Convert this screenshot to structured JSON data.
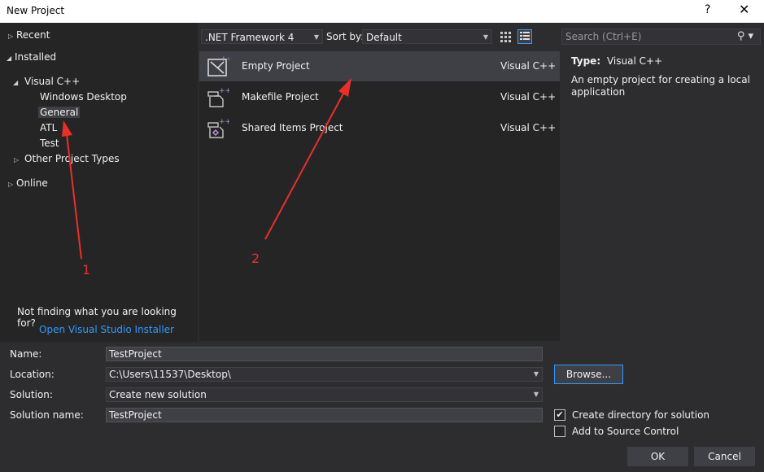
{
  "window": {
    "title": "New Project",
    "help": "?",
    "close": "✕"
  },
  "tree": {
    "recent": "Recent",
    "installed": "Installed",
    "visual_cpp": "Visual C++",
    "windows_desktop": "Windows Desktop",
    "general": "General",
    "atl": "ATL",
    "test": "Test",
    "other_types": "Other Project Types",
    "online": "Online"
  },
  "left_footer": {
    "not_finding": "Not finding what you are looking for?",
    "installer_link": "Open Visual Studio Installer"
  },
  "toolbar": {
    "framework": ".NET Framework 4",
    "sort_by_label": "Sort by:",
    "sort_value": "Default"
  },
  "projects": [
    {
      "name": "Empty Project",
      "lang": "Visual C++"
    },
    {
      "name": "Makefile Project",
      "lang": "Visual C++"
    },
    {
      "name": "Shared Items Project",
      "lang": "Visual C++"
    }
  ],
  "details": {
    "search_placeholder": "Search (Ctrl+E)",
    "type_label": "Type:",
    "type_value": "Visual C++",
    "description": "An empty project for creating a local application"
  },
  "form": {
    "name_label": "Name:",
    "name_value": "TestProject",
    "location_label": "Location:",
    "location_value": "C:\\Users\\11537\\Desktop\\",
    "solution_label": "Solution:",
    "solution_value": "Create new solution",
    "solution_name_label": "Solution name:",
    "solution_name_value": "TestProject",
    "browse": "Browse...",
    "create_dir": "Create directory for solution",
    "create_dir_checked": true,
    "source_control": "Add to Source Control",
    "source_control_checked": false,
    "ok": "OK",
    "cancel": "Cancel"
  },
  "annotations": {
    "one": "1",
    "two": "2",
    "color": "#e8302a"
  },
  "colors": {
    "background": "#2d2d30",
    "pane": "#252526",
    "selection": "#3f3f46",
    "link": "#3399ff"
  }
}
